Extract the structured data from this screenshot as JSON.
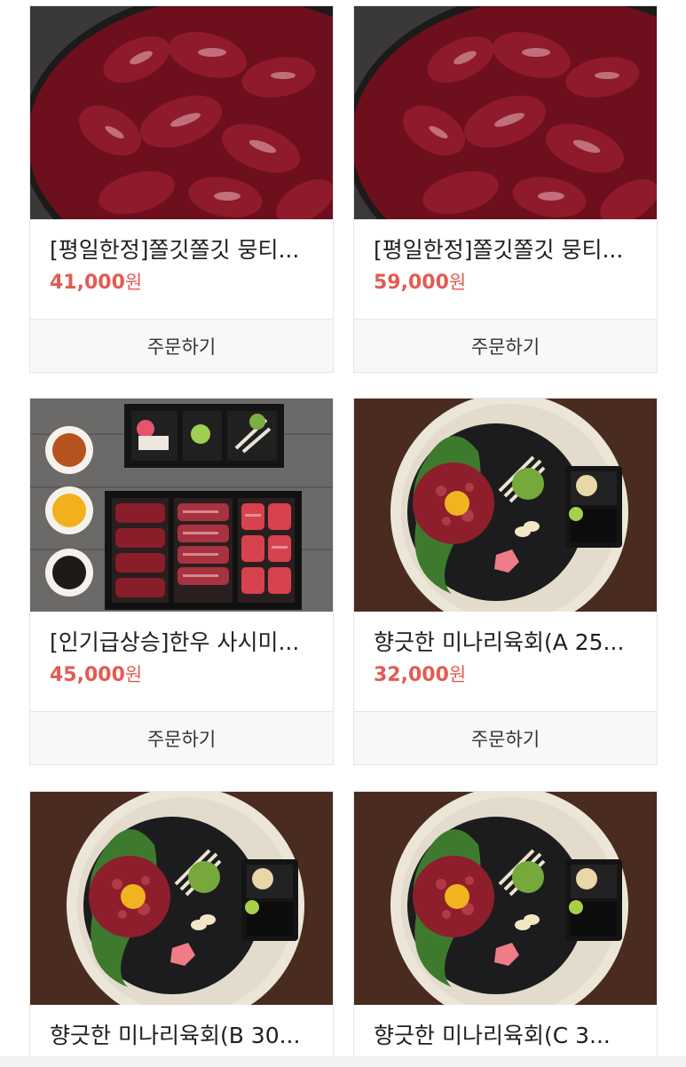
{
  "products": [
    {
      "name": "[평일한정]쫄깃쫄깃 뭉티...",
      "price": "41,000",
      "currency": "원",
      "order_label": "주문하기",
      "image": "sliced-raw-beef-plate"
    },
    {
      "name": "[평일한정]쫄깃쫄깃 뭉티...",
      "price": "59,000",
      "currency": "원",
      "order_label": "주문하기",
      "image": "sliced-raw-beef-plate"
    },
    {
      "name": "[인기급상승]한우 사시미...",
      "price": "45,000",
      "currency": "원",
      "order_label": "주문하기",
      "image": "beef-sashimi-set-tray"
    },
    {
      "name": "향긋한 미나리육회(A 25...",
      "price": "32,000",
      "currency": "원",
      "order_label": "주문하기",
      "image": "yukhoe-plate"
    },
    {
      "name": "향긋한 미나리육회(B 30...",
      "price": "",
      "currency": "",
      "order_label": "",
      "image": "yukhoe-plate"
    },
    {
      "name": "향긋한 미나리육회(C 3...",
      "price": "",
      "currency": "",
      "order_label": "",
      "image": "yukhoe-plate"
    }
  ],
  "colors": {
    "price": "#e35b52",
    "button_bg": "#f7f8fa",
    "border": "#e6e6e6"
  }
}
